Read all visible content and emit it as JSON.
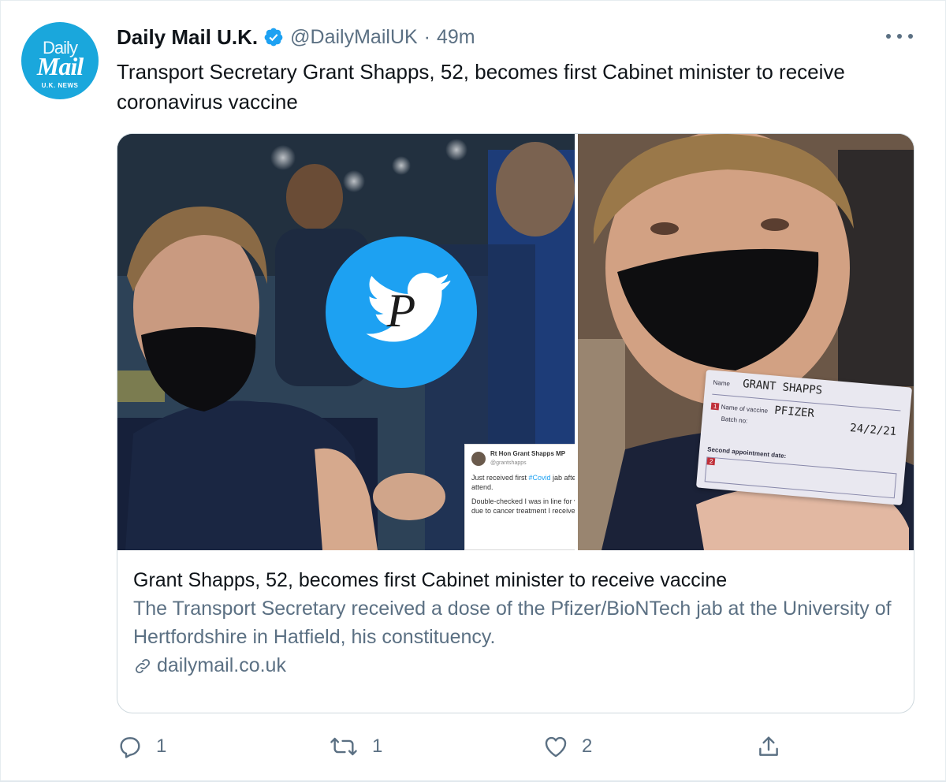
{
  "tweet": {
    "avatar": {
      "line1": "Daily",
      "line2": "Mail",
      "line3": "U.K. NEWS"
    },
    "author_name": "Daily Mail U.K.",
    "handle": "@DailyMailUK",
    "separator": "·",
    "time": "49m",
    "text": "Transport Secretary Grant Shapps, 52, becomes first Cabinet minister to receive coronavirus vaccine"
  },
  "card": {
    "embedded_tweet": {
      "name": "Rt Hon Grant Shapps MP",
      "handle": "@grantshapps",
      "line1_pre": "Just received first ",
      "hashtag": "#Covid",
      "line1_post": " jab after getting call from GP Surgery to attend.",
      "line2": "Double-checked I was in line for vaccine & NHS confirmed it was due to cancer treatment I received over two decades ago."
    },
    "vaccine_card": {
      "name_label": "Name",
      "name_value": "GRANT SHAPPS",
      "vaccine_label": "Name of vaccine",
      "vaccine_value": "PFIZER",
      "batch_label": "Batch no:",
      "date_value": "24/2/21",
      "second_label": "Second appointment date:"
    },
    "title": "Grant Shapps, 52, becomes first Cabinet minister to receive vaccine",
    "description": "The Transport Secretary received a dose of the Pfizer/BioNTech jab at the University of Hertfordshire in Hatfield, his constituency.",
    "link": "dailymail.co.uk"
  },
  "actions": {
    "reply_count": "1",
    "retweet_count": "1",
    "like_count": "2"
  },
  "colors": {
    "accent": "#1da1f2",
    "muted": "#5b7083",
    "avatar_bg": "#1aa7dc"
  }
}
